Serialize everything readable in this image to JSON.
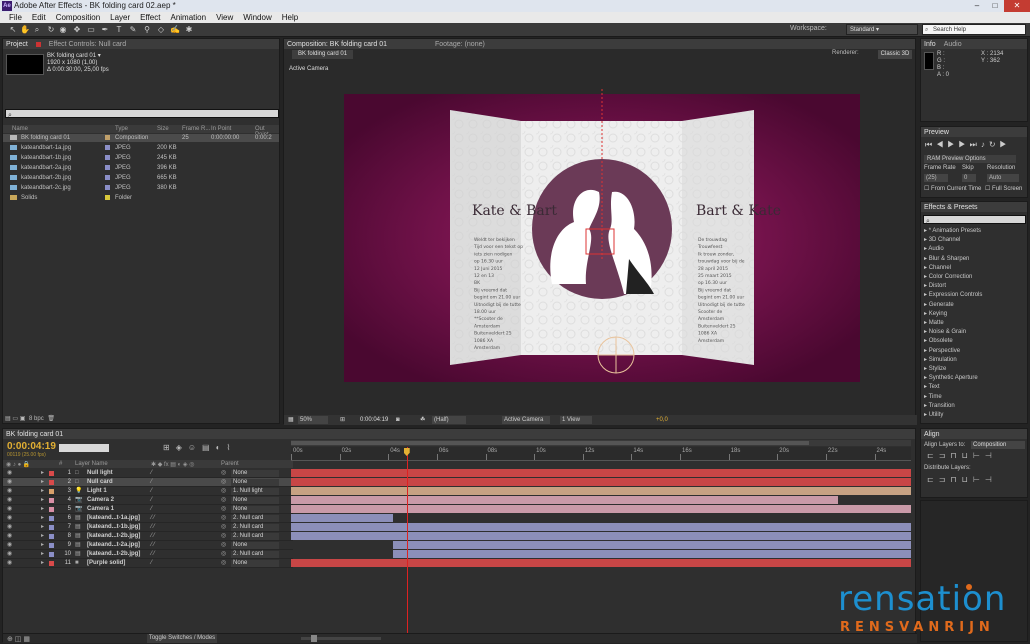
{
  "titlebar": {
    "title": "Adobe After Effects - BK folding card 02.aep *",
    "app_icon": "Ae"
  },
  "menu": [
    "File",
    "Edit",
    "Composition",
    "Layer",
    "Effect",
    "Animation",
    "View",
    "Window",
    "Help"
  ],
  "workspace": {
    "label": "Workspace:",
    "value": "Standard"
  },
  "search_help": {
    "placeholder": "Search Help"
  },
  "project": {
    "tabs": {
      "project": "Project",
      "effect_controls": "Effect Controls: Null card"
    },
    "preview": {
      "name": "BK folding card 01 ▾",
      "size": "1920 x 1080 (1,00)",
      "duration": "Δ 0:00:30:00, 25,00 fps"
    },
    "columns": [
      "Name",
      "Type",
      "Size",
      "Frame R...",
      "In Point",
      "Out Point"
    ],
    "items": [
      {
        "name": "BK folding card 01",
        "type": "Composition",
        "size": "",
        "fr": "25",
        "in": "0:00:00:00",
        "out": "0:00:2",
        "kind": "comp"
      },
      {
        "name": "kateandbart-1a.jpg",
        "type": "JPEG",
        "size": "200 KB",
        "fr": "",
        "in": "",
        "out": "",
        "kind": "jpg"
      },
      {
        "name": "kateandbart-1b.jpg",
        "type": "JPEG",
        "size": "245 KB",
        "fr": "",
        "in": "",
        "out": "",
        "kind": "jpg"
      },
      {
        "name": "kateandbart-2a.jpg",
        "type": "JPEG",
        "size": "396 KB",
        "fr": "",
        "in": "",
        "out": "",
        "kind": "jpg"
      },
      {
        "name": "kateandbart-2b.jpg",
        "type": "JPEG",
        "size": "665 KB",
        "fr": "",
        "in": "",
        "out": "",
        "kind": "jpg"
      },
      {
        "name": "kateandbart-2c.jpg",
        "type": "JPEG",
        "size": "380 KB",
        "fr": "",
        "in": "",
        "out": "",
        "kind": "jpg"
      },
      {
        "name": "Solids",
        "type": "Folder",
        "size": "",
        "fr": "",
        "in": "",
        "out": "",
        "kind": "folder"
      }
    ],
    "bpc": "8 bpc"
  },
  "comp": {
    "tab": "Composition: BK folding card 01",
    "footage_tab": "Footage: (none)",
    "subtab": "BK folding card 01",
    "view": "Active Camera",
    "renderer_label": "Renderer:",
    "renderer": "Classic 3D",
    "card": {
      "left_names": "Kate & Bart",
      "right_names": "Bart & Kate",
      "left_text": [
        "Weldt ter bekijken",
        "Tijd voor een tekst op",
        "iets zien nodigen",
        "op 16.30 uur",
        "12 Juni 2015",
        "12 en 13",
        "BK",
        "Bij vreemd dat",
        "begint om 21.00 uur",
        "Uitnodigt bij de tutte",
        "18.00 uur",
        "**Scooter de",
        "Amsterdam",
        "Buitenveldert 25",
        "1086 XA",
        "Amsterdam"
      ],
      "right_text": [
        "De trouwdag",
        "Trouwfeest",
        "Ik trouw zonder,",
        "trouwdag voor bij de",
        "28 april 2015",
        "25 maart 2015",
        "op 16.30 uur",
        "Bij vreemd dat",
        "begint om 21.00 uur",
        "Uitnodigt bij de tutte",
        "Scooter de",
        "Amsterdam",
        "Buitenveldert 25",
        "1086 XA",
        "Amsterdam"
      ]
    },
    "footer": {
      "zoom": "50%",
      "timecode": "0:00:04:19",
      "resolution": "(Half)",
      "camera": "Active Camera",
      "views": "1 View",
      "exposure": "+0,0"
    }
  },
  "info": {
    "tabs": {
      "info": "Info",
      "audio": "Audio"
    },
    "r": "R :",
    "g": "G :",
    "b": "B :",
    "a": "A : 0",
    "x": "X : 2134",
    "y": "Y : 362"
  },
  "preview_panel": {
    "tab": "Preview",
    "options": "RAM Preview Options",
    "frame_rate_label": "Frame Rate",
    "skip_label": "Skip",
    "resolution_label": "Resolution",
    "frame_rate": "(25)",
    "skip": "0",
    "resolution": "Auto",
    "from_current": "From Current Time",
    "full_screen": "Full Screen"
  },
  "effects": {
    "tab": "Effects & Presets",
    "items": [
      "* Animation Presets",
      "3D Channel",
      "Audio",
      "Blur & Sharpen",
      "Channel",
      "Color Correction",
      "Distort",
      "Expression Controls",
      "Generate",
      "Keying",
      "Matte",
      "Noise & Grain",
      "Obsolete",
      "Perspective",
      "Simulation",
      "Stylize",
      "Synthetic Aperture",
      "Text",
      "Time",
      "Transition",
      "Utility"
    ]
  },
  "timeline": {
    "tab": "BK folding card 01",
    "timecode": "0:00:04:19",
    "frame": "00119 (25.00 fps)",
    "col_hash": "#",
    "col_name": "Layer Name",
    "col_parent": "Parent",
    "ruler": [
      "00s",
      "02s",
      "04s",
      "06s",
      "08s",
      "10s",
      "12s",
      "14s",
      "16s",
      "18s",
      "20s",
      "22s",
      "24s"
    ],
    "playhead_time": 4.76,
    "duration": 25.5,
    "layers": [
      {
        "num": "1",
        "name": "Null light",
        "parent": "None",
        "label": "#d94a4a",
        "icon": "null",
        "bar": "#c84646",
        "start": 0,
        "end": 25.5
      },
      {
        "num": "2",
        "name": "Null card",
        "parent": "None",
        "label": "#d94a4a",
        "icon": "null",
        "bar": "#c84646",
        "start": 0,
        "end": 25.5,
        "selected": true
      },
      {
        "num": "3",
        "name": "Light 1",
        "parent": "1. Null light",
        "label": "#d9a06a",
        "icon": "light",
        "bar": "#c7a283",
        "start": 0,
        "end": 25.5
      },
      {
        "num": "4",
        "name": "Camera 2",
        "parent": "None",
        "label": "#d98fa6",
        "icon": "camera",
        "bar": "#c99aa8",
        "start": 0,
        "end": 22.5
      },
      {
        "num": "5",
        "name": "Camera 1",
        "parent": "None",
        "label": "#d98fa6",
        "icon": "camera",
        "bar": "#c99aa8",
        "start": 0,
        "end": 25.5
      },
      {
        "num": "6",
        "name": "[kateand...t-1a.jpg]",
        "parent": "2. Null card",
        "label": "#8b8fc7",
        "icon": "jpg",
        "bar": "#8c8fb9",
        "start": 0,
        "end": 4.2
      },
      {
        "num": "7",
        "name": "[kateand...t-1b.jpg]",
        "parent": "2. Null card",
        "label": "#8b8fc7",
        "icon": "jpg",
        "bar": "#8c8fb9",
        "start": 0,
        "end": 25.5
      },
      {
        "num": "8",
        "name": "[kateand...t-2b.jpg]",
        "parent": "2. Null card",
        "label": "#8b8fc7",
        "icon": "jpg",
        "bar": "#8c8fb9",
        "start": 0,
        "end": 25.5
      },
      {
        "num": "9",
        "name": "[kateand...t-2a.jpg]",
        "parent": "None",
        "label": "#8b8fc7",
        "icon": "jpg",
        "bar": "#8c8fb9",
        "start": 4.2,
        "end": 25.5
      },
      {
        "num": "10",
        "name": "[kateand...t-2b.jpg]",
        "parent": "2. Null card",
        "label": "#8b8fc7",
        "icon": "jpg",
        "bar": "#8c8fb9",
        "start": 4.2,
        "end": 25.5
      },
      {
        "num": "11",
        "name": "[Purple solid]",
        "parent": "None",
        "label": "#d94a4a",
        "icon": "solid",
        "bar": "#c84646",
        "start": 0,
        "end": 25.5
      }
    ],
    "toggle_label": "Toggle Switches / Modes"
  },
  "align": {
    "tab": "Align",
    "align_to_label": "Align Layers to:",
    "align_to": "Composition",
    "distribute": "Distribute Layers:"
  },
  "watermark": {
    "top": "rensation",
    "bottom": "RENSVANRIJN"
  },
  "colors": {
    "panel": "#2f2f2f",
    "accent": "#e8a33c",
    "bg_magenta": "#6a0f45",
    "timecode": "#e3b033"
  }
}
